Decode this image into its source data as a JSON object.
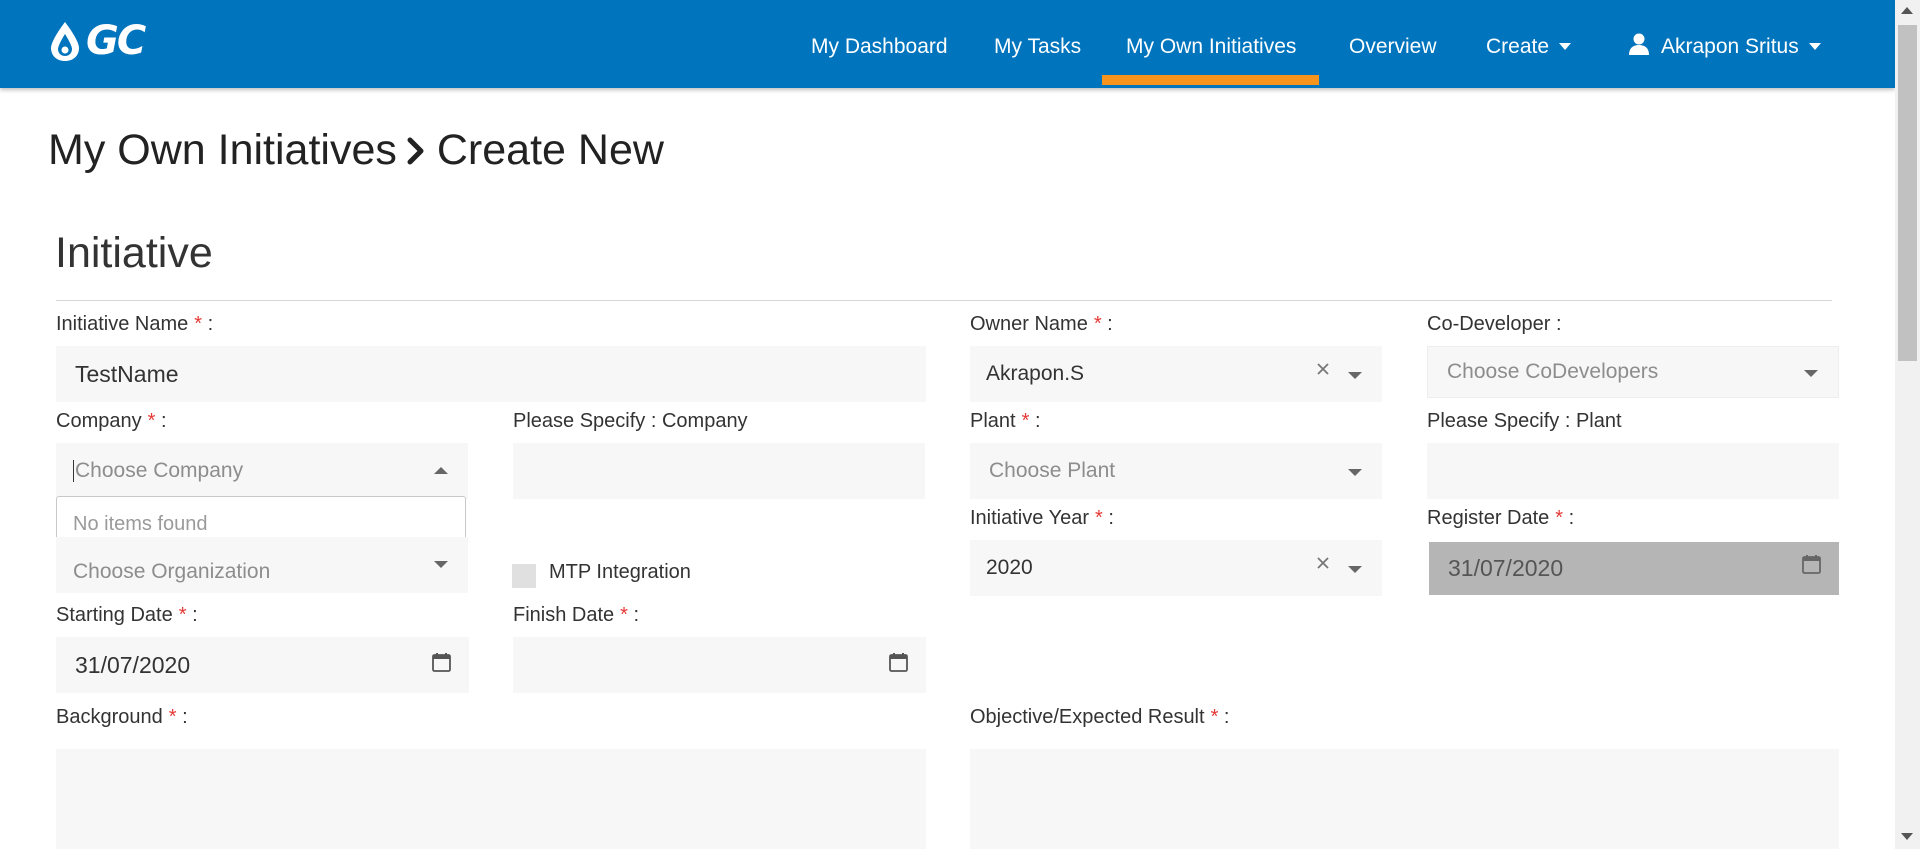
{
  "brand": {
    "logo_text": "GC"
  },
  "nav": {
    "items": [
      {
        "label": "My Dashboard"
      },
      {
        "label": "My Tasks"
      },
      {
        "label": "My Own Initiatives"
      },
      {
        "label": "Overview"
      },
      {
        "label": "Create"
      }
    ],
    "active": "My Own Initiatives",
    "user": "Akrapon Sritus"
  },
  "breadcrumb": {
    "parent": "My Own Initiatives",
    "current": "Create New"
  },
  "section_title": "Initiative",
  "form": {
    "initiative_name": {
      "label": "Initiative Name",
      "value": "TestName"
    },
    "owner_name": {
      "label": "Owner Name",
      "value": "Akrapon.S"
    },
    "co_developer": {
      "label": "Co-Developer :",
      "placeholder": "Choose CoDevelopers"
    },
    "company": {
      "label": "Company",
      "placeholder": "Choose Company",
      "dropdown_message": "No items found"
    },
    "specify_company": {
      "label": "Please Specify : Company",
      "value": ""
    },
    "plant": {
      "label": "Plant",
      "placeholder": "Choose Plant"
    },
    "specify_plant": {
      "label": "Please Specify : Plant",
      "value": ""
    },
    "organization": {
      "placeholder": "Choose Organization"
    },
    "mtp_integration": {
      "label": "MTP Integration",
      "checked": false
    },
    "initiative_year": {
      "label": "Initiative Year",
      "value": "2020"
    },
    "register_date": {
      "label": "Register Date",
      "value": "31/07/2020"
    },
    "starting_date": {
      "label": "Starting Date",
      "value": "31/07/2020"
    },
    "finish_date": {
      "label": "Finish Date",
      "value": ""
    },
    "background": {
      "label": "Background",
      "value": ""
    },
    "objective": {
      "label": "Objective/Expected Result",
      "value": ""
    }
  },
  "required_marker": "*",
  "label_suffix": ":",
  "colors": {
    "navbar": "#0074bd",
    "active_tab": "#f7941d",
    "required": "#e53935"
  }
}
